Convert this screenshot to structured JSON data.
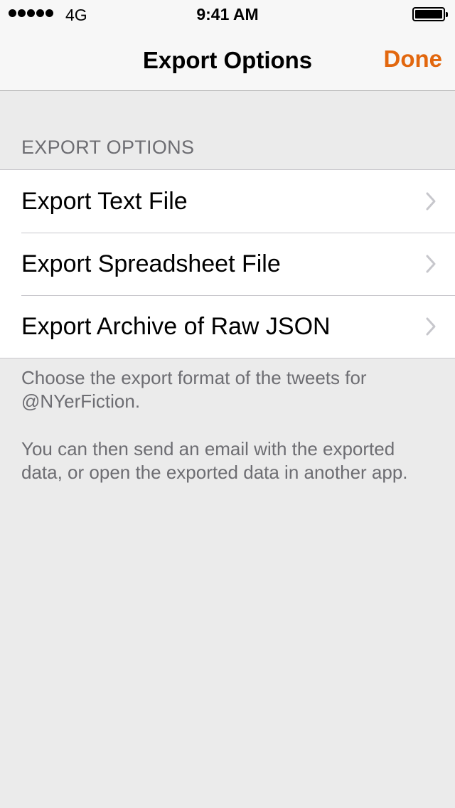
{
  "status_bar": {
    "carrier": "4G",
    "time": "9:41 AM",
    "signal_icon": "signal-dots-icon",
    "battery_icon": "battery-icon"
  },
  "nav": {
    "title": "Export Options",
    "done_label": "Done",
    "accent_color": "#e2670e"
  },
  "section": {
    "header": "EXPORT OPTIONS",
    "items": [
      {
        "label": "Export Text File",
        "icon": "chevron-right-icon"
      },
      {
        "label": "Export Spreadsheet File",
        "icon": "chevron-right-icon"
      },
      {
        "label": "Export Archive of Raw JSON",
        "icon": "chevron-right-icon"
      }
    ],
    "footer_line1": "Choose the export format of the tweets for @NYerFiction.",
    "footer_line2": "You can then send an email with the exported data, or open the exported data in another app."
  }
}
